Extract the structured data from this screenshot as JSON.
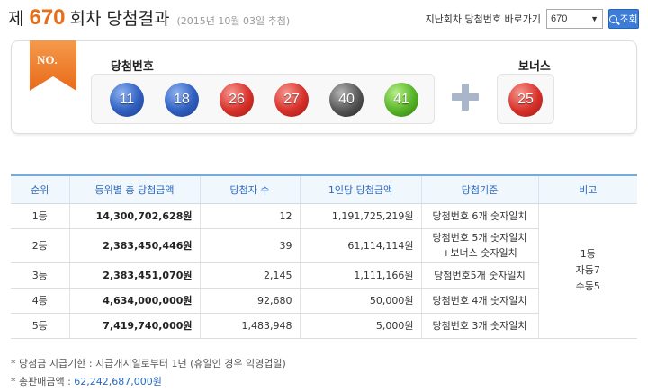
{
  "header": {
    "prefix": "제",
    "round": "670",
    "suffix": "회차 당첨결과",
    "draw_date": "(2015년 10월 03일 추첨)",
    "jump_label": "지난회차 당첨번호 바로가기",
    "select_value": "670",
    "search_button": "조회"
  },
  "result": {
    "badge": "NO.",
    "winning_label": "당첨번호",
    "bonus_label": "보너스",
    "numbers": [
      {
        "value": "11",
        "color": "#2f5fc0"
      },
      {
        "value": "18",
        "color": "#2f5fc0"
      },
      {
        "value": "26",
        "color": "#d8302a"
      },
      {
        "value": "27",
        "color": "#d8302a"
      },
      {
        "value": "40",
        "color": "#555555"
      },
      {
        "value": "41",
        "color": "#56b326"
      }
    ],
    "bonus": {
      "value": "25",
      "color": "#d8302a"
    }
  },
  "table": {
    "headers": [
      "순위",
      "등위별 총 당첨금액",
      "당첨자 수",
      "1인당 당첨금액",
      "당첨기준",
      "비고"
    ],
    "rows": [
      {
        "rank": "1등",
        "total": "14,300,702,628원",
        "winners": "12",
        "per_person": "1,191,725,219원",
        "criteria": "당첨번호 6개 숫자일치"
      },
      {
        "rank": "2등",
        "total": "2,383,450,446원",
        "winners": "39",
        "per_person": "61,114,114원",
        "criteria": "당첨번호 5개 숫자일치",
        "criteria2": "+보너스 숫자일치"
      },
      {
        "rank": "3등",
        "total": "2,383,451,070원",
        "winners": "2,145",
        "per_person": "1,111,166원",
        "criteria": "당첨번호5개 숫자일치"
      },
      {
        "rank": "4등",
        "total": "4,634,000,000원",
        "winners": "92,680",
        "per_person": "50,000원",
        "criteria": "당첨번호 4개 숫자일치"
      },
      {
        "rank": "5등",
        "total": "7,419,740,000원",
        "winners": "1,483,948",
        "per_person": "5,000원",
        "criteria": "당첨번호 3개 숫자일치"
      }
    ],
    "note": [
      "1등",
      "자동7",
      "수동5"
    ]
  },
  "footer": {
    "deadline": "* 당첨금 지급기한 : 지급개시일로부터 1년 (휴일인 경우 익영업일)",
    "sales_label": "* 총판매금액 : ",
    "sales_value": "62,242,687,000원"
  }
}
